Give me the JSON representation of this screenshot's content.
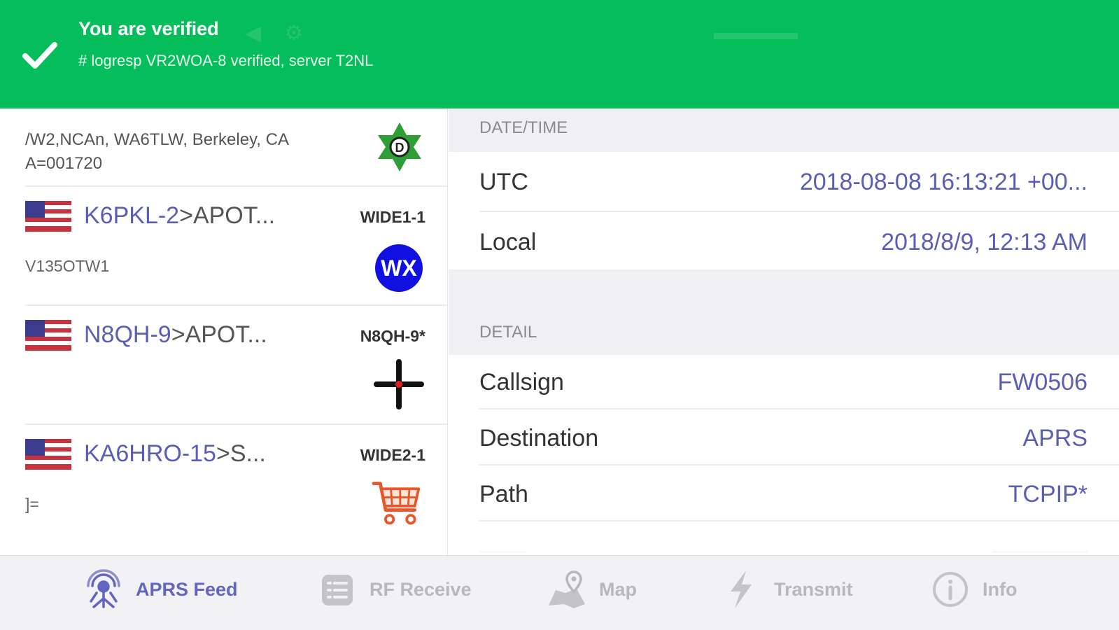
{
  "banner": {
    "title": "You are verified",
    "message": "# logresp VR2WOA-8 verified, server T2NL",
    "color": "#05bd5b"
  },
  "feed": {
    "partial_row": {
      "text_line1": "/W2,NCAn, WA6TLW, Berkeley, CA",
      "text_line2": "A=001720",
      "symbol_icon": "green-star-digi-icon"
    },
    "items": [
      {
        "source": "K6PKL-2",
        "dest": ">APOT...",
        "path": "WIDE1-1",
        "comment": "V135OTW1",
        "symbol_icon": "wx-icon",
        "symbol_text": "WX",
        "flag_icon": "us-flag-icon"
      },
      {
        "source": "N8QH-9",
        "dest": ">APOT...",
        "path": "N8QH-9*",
        "comment": "",
        "symbol_icon": "crosshair-icon",
        "flag_icon": "us-flag-icon"
      },
      {
        "source": "KA6HRO-15",
        "dest": ">S...",
        "path": "WIDE2-1",
        "comment": "]=",
        "symbol_icon": "shopping-cart-icon",
        "flag_icon": "us-flag-icon"
      }
    ]
  },
  "detail": {
    "datetime_header": "DATE/TIME",
    "utc_label": "UTC",
    "utc_value": "2018-08-08 16:13:21 +00...",
    "local_label": "Local",
    "local_value": "2018/8/9, 12:13 AM",
    "detail_header": "DETAIL",
    "callsign_label": "Callsign",
    "callsign_value": "FW0506",
    "destination_label": "Destination",
    "destination_value": "APRS",
    "path_label": "Path",
    "path_value": "TCPIP*"
  },
  "tabs": [
    {
      "label": "APRS Feed",
      "icon": "aprs-feed-icon",
      "active": true
    },
    {
      "label": "RF Receive",
      "icon": "rf-receive-icon",
      "active": false
    },
    {
      "label": "Map",
      "icon": "map-icon",
      "active": false
    },
    {
      "label": "Transmit",
      "icon": "transmit-icon",
      "active": false
    },
    {
      "label": "Info",
      "icon": "info-icon",
      "active": false
    }
  ],
  "colors": {
    "accent": "#6366c0",
    "link": "#5a5fb5",
    "wx_badge": "#1010e0",
    "digi_star": "#2e9e35",
    "cart": "#e8562a"
  }
}
